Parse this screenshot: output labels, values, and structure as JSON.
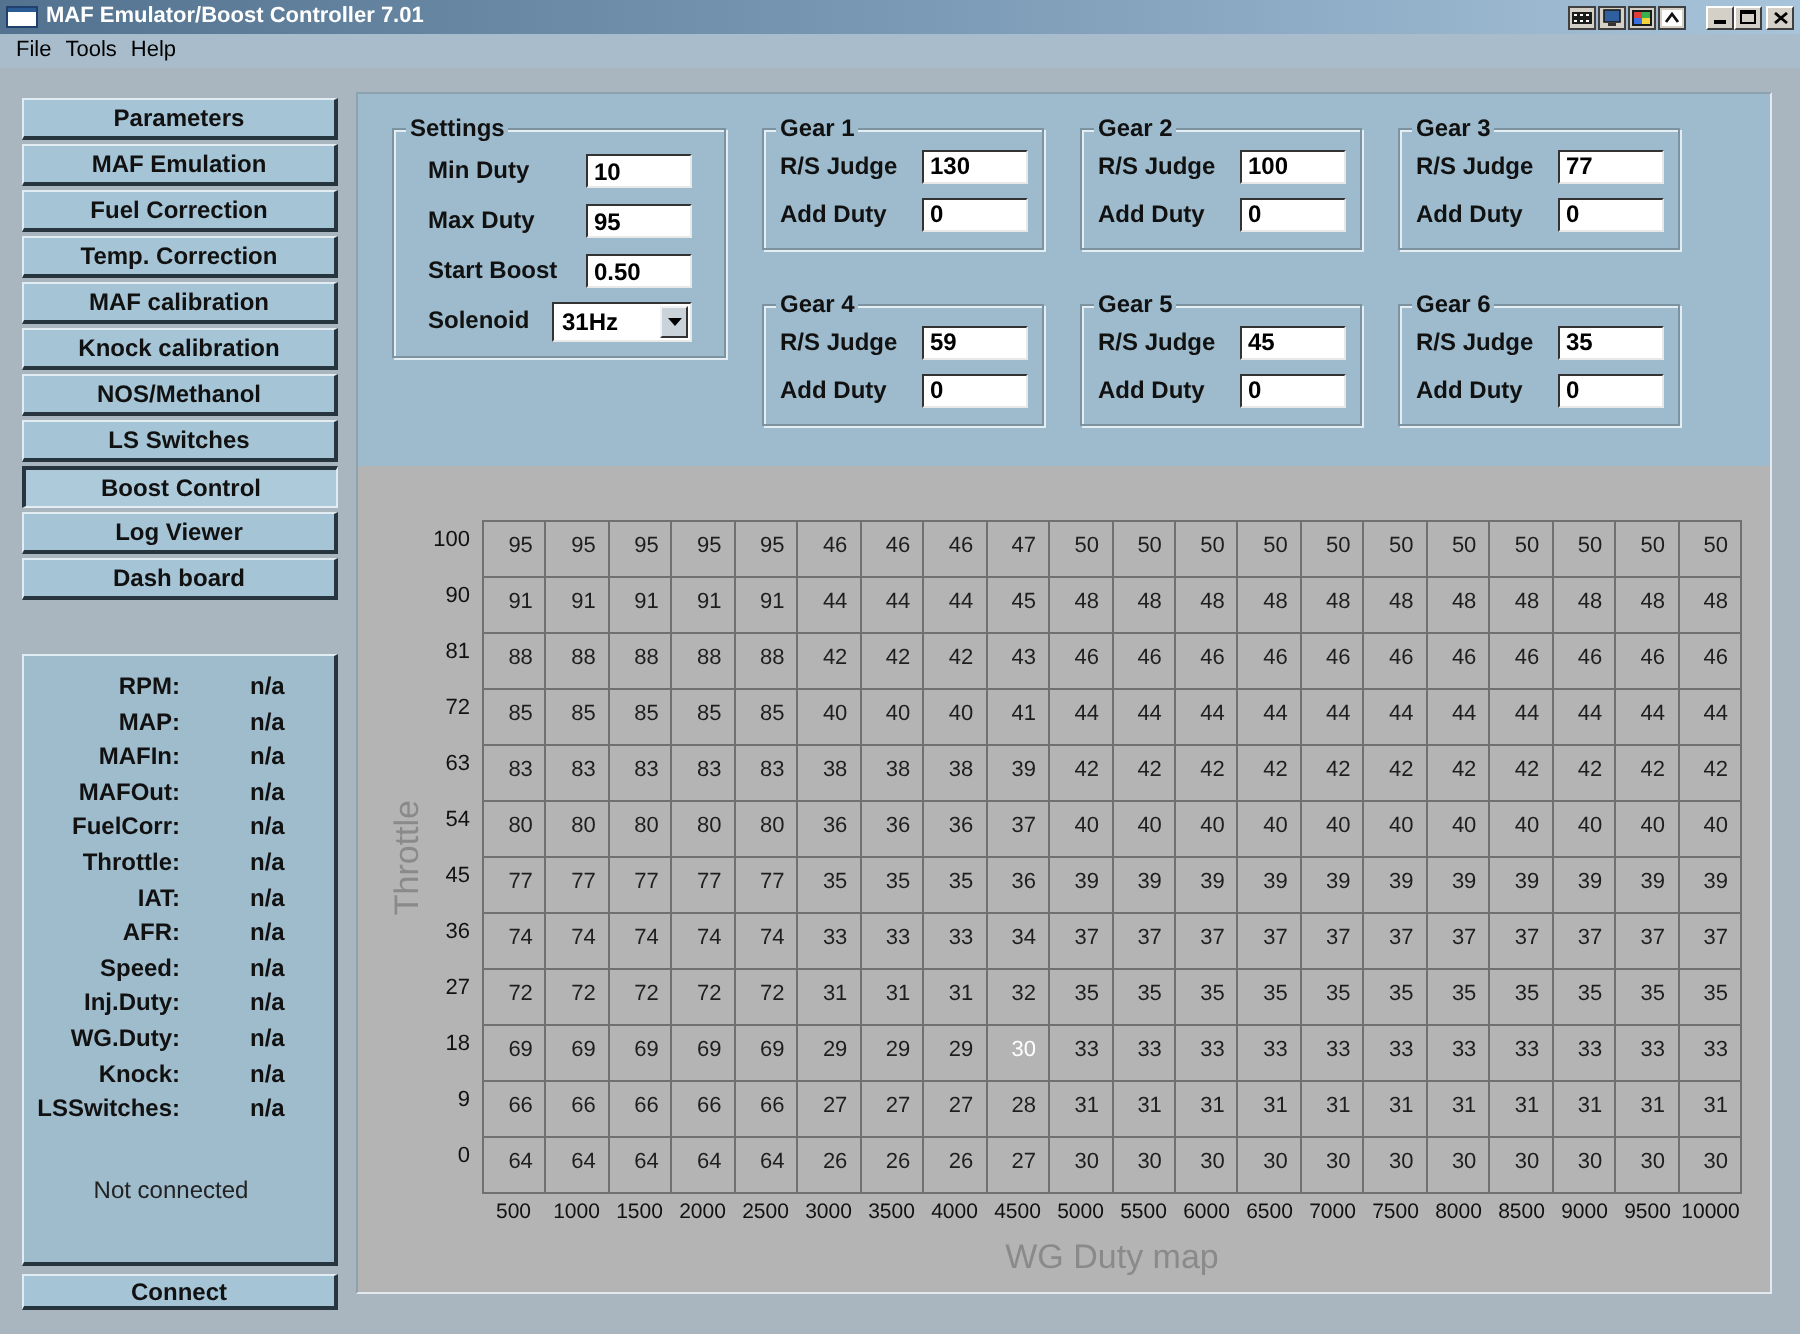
{
  "window": {
    "title": "MAF Emulator/Boost Controller 7.01"
  },
  "menu": [
    "File",
    "Tools",
    "Help"
  ],
  "nav_buttons": [
    {
      "label": "Parameters",
      "selected": false
    },
    {
      "label": "MAF Emulation",
      "selected": false
    },
    {
      "label": "Fuel Correction",
      "selected": false
    },
    {
      "label": "Temp. Correction",
      "selected": false
    },
    {
      "label": "MAF calibration",
      "selected": false
    },
    {
      "label": "Knock calibration",
      "selected": false
    },
    {
      "label": "NOS/Methanol",
      "selected": false
    },
    {
      "label": "LS Switches",
      "selected": false
    },
    {
      "label": "Boost Control",
      "selected": true
    },
    {
      "label": "Log Viewer",
      "selected": false
    },
    {
      "label": "Dash board",
      "selected": false
    }
  ],
  "status_panel": {
    "readings": [
      {
        "label": "RPM:",
        "value": "n/a"
      },
      {
        "label": "MAP:",
        "value": "n/a"
      },
      {
        "label": "MAFIn:",
        "value": "n/a"
      },
      {
        "label": "MAFOut:",
        "value": "n/a"
      },
      {
        "label": "FuelCorr:",
        "value": "n/a"
      },
      {
        "label": "Throttle:",
        "value": "n/a"
      },
      {
        "label": "IAT:",
        "value": "n/a"
      },
      {
        "label": "AFR:",
        "value": "n/a"
      },
      {
        "label": "Speed:",
        "value": "n/a"
      },
      {
        "label": "Inj.Duty:",
        "value": "n/a"
      },
      {
        "label": "WG.Duty:",
        "value": "n/a"
      },
      {
        "label": "Knock:",
        "value": "n/a"
      },
      {
        "label": "LSSwitches:",
        "value": "n/a"
      }
    ],
    "message": "Not connected"
  },
  "connect_button": "Connect",
  "settings": {
    "title": "Settings",
    "fields": [
      {
        "kind": "input",
        "label": "Min Duty",
        "value": "10"
      },
      {
        "kind": "input",
        "label": "Max Duty",
        "value": "95"
      },
      {
        "kind": "input",
        "label": "Start Boost",
        "value": "0.50"
      },
      {
        "kind": "dropdown",
        "label": "Solenoid",
        "value": "31Hz"
      }
    ]
  },
  "gears": [
    {
      "title": "Gear 1",
      "fields": [
        {
          "label": "R/S Judge",
          "value": "130"
        },
        {
          "label": "Add Duty",
          "value": "0"
        }
      ]
    },
    {
      "title": "Gear 2",
      "fields": [
        {
          "label": "R/S Judge",
          "value": "100"
        },
        {
          "label": "Add Duty",
          "value": "0"
        }
      ]
    },
    {
      "title": "Gear 3",
      "fields": [
        {
          "label": "R/S Judge",
          "value": "77"
        },
        {
          "label": "Add Duty",
          "value": "0"
        }
      ]
    },
    {
      "title": "Gear 4",
      "fields": [
        {
          "label": "R/S Judge",
          "value": "59"
        },
        {
          "label": "Add Duty",
          "value": "0"
        }
      ]
    },
    {
      "title": "Gear 5",
      "fields": [
        {
          "label": "R/S Judge",
          "value": "45"
        },
        {
          "label": "Add Duty",
          "value": "0"
        }
      ]
    },
    {
      "title": "Gear 6",
      "fields": [
        {
          "label": "R/S Judge",
          "value": "35"
        },
        {
          "label": "Add Duty",
          "value": "0"
        }
      ]
    }
  ],
  "duty_map": {
    "y_label": "Throttle",
    "rows": [
      {
        "label": "100",
        "cells": [
          {
            "value": "95",
            "selected": false
          },
          {
            "value": "95",
            "selected": false
          },
          {
            "value": "95",
            "selected": false
          },
          {
            "value": "95",
            "selected": false
          },
          {
            "value": "95",
            "selected": false
          },
          {
            "value": "46",
            "selected": false
          },
          {
            "value": "46",
            "selected": false
          },
          {
            "value": "46",
            "selected": false
          },
          {
            "value": "47",
            "selected": false
          },
          {
            "value": "50",
            "selected": false
          },
          {
            "value": "50",
            "selected": false
          },
          {
            "value": "50",
            "selected": false
          },
          {
            "value": "50",
            "selected": false
          },
          {
            "value": "50",
            "selected": false
          },
          {
            "value": "50",
            "selected": false
          },
          {
            "value": "50",
            "selected": false
          },
          {
            "value": "50",
            "selected": false
          },
          {
            "value": "50",
            "selected": false
          },
          {
            "value": "50",
            "selected": false
          },
          {
            "value": "50",
            "selected": false
          }
        ]
      },
      {
        "label": "90",
        "cells": [
          {
            "value": "91",
            "selected": false
          },
          {
            "value": "91",
            "selected": false
          },
          {
            "value": "91",
            "selected": false
          },
          {
            "value": "91",
            "selected": false
          },
          {
            "value": "91",
            "selected": false
          },
          {
            "value": "44",
            "selected": false
          },
          {
            "value": "44",
            "selected": false
          },
          {
            "value": "44",
            "selected": false
          },
          {
            "value": "45",
            "selected": false
          },
          {
            "value": "48",
            "selected": false
          },
          {
            "value": "48",
            "selected": false
          },
          {
            "value": "48",
            "selected": false
          },
          {
            "value": "48",
            "selected": false
          },
          {
            "value": "48",
            "selected": false
          },
          {
            "value": "48",
            "selected": false
          },
          {
            "value": "48",
            "selected": false
          },
          {
            "value": "48",
            "selected": false
          },
          {
            "value": "48",
            "selected": false
          },
          {
            "value": "48",
            "selected": false
          },
          {
            "value": "48",
            "selected": false
          }
        ]
      },
      {
        "label": "81",
        "cells": [
          {
            "value": "88",
            "selected": false
          },
          {
            "value": "88",
            "selected": false
          },
          {
            "value": "88",
            "selected": false
          },
          {
            "value": "88",
            "selected": false
          },
          {
            "value": "88",
            "selected": false
          },
          {
            "value": "42",
            "selected": false
          },
          {
            "value": "42",
            "selected": false
          },
          {
            "value": "42",
            "selected": false
          },
          {
            "value": "43",
            "selected": false
          },
          {
            "value": "46",
            "selected": false
          },
          {
            "value": "46",
            "selected": false
          },
          {
            "value": "46",
            "selected": false
          },
          {
            "value": "46",
            "selected": false
          },
          {
            "value": "46",
            "selected": false
          },
          {
            "value": "46",
            "selected": false
          },
          {
            "value": "46",
            "selected": false
          },
          {
            "value": "46",
            "selected": false
          },
          {
            "value": "46",
            "selected": false
          },
          {
            "value": "46",
            "selected": false
          },
          {
            "value": "46",
            "selected": false
          }
        ]
      },
      {
        "label": "72",
        "cells": [
          {
            "value": "85",
            "selected": false
          },
          {
            "value": "85",
            "selected": false
          },
          {
            "value": "85",
            "selected": false
          },
          {
            "value": "85",
            "selected": false
          },
          {
            "value": "85",
            "selected": false
          },
          {
            "value": "40",
            "selected": false
          },
          {
            "value": "40",
            "selected": false
          },
          {
            "value": "40",
            "selected": false
          },
          {
            "value": "41",
            "selected": false
          },
          {
            "value": "44",
            "selected": false
          },
          {
            "value": "44",
            "selected": false
          },
          {
            "value": "44",
            "selected": false
          },
          {
            "value": "44",
            "selected": false
          },
          {
            "value": "44",
            "selected": false
          },
          {
            "value": "44",
            "selected": false
          },
          {
            "value": "44",
            "selected": false
          },
          {
            "value": "44",
            "selected": false
          },
          {
            "value": "44",
            "selected": false
          },
          {
            "value": "44",
            "selected": false
          },
          {
            "value": "44",
            "selected": false
          }
        ]
      },
      {
        "label": "63",
        "cells": [
          {
            "value": "83",
            "selected": false
          },
          {
            "value": "83",
            "selected": false
          },
          {
            "value": "83",
            "selected": false
          },
          {
            "value": "83",
            "selected": false
          },
          {
            "value": "83",
            "selected": false
          },
          {
            "value": "38",
            "selected": false
          },
          {
            "value": "38",
            "selected": false
          },
          {
            "value": "38",
            "selected": false
          },
          {
            "value": "39",
            "selected": false
          },
          {
            "value": "42",
            "selected": false
          },
          {
            "value": "42",
            "selected": false
          },
          {
            "value": "42",
            "selected": false
          },
          {
            "value": "42",
            "selected": false
          },
          {
            "value": "42",
            "selected": false
          },
          {
            "value": "42",
            "selected": false
          },
          {
            "value": "42",
            "selected": false
          },
          {
            "value": "42",
            "selected": false
          },
          {
            "value": "42",
            "selected": false
          },
          {
            "value": "42",
            "selected": false
          },
          {
            "value": "42",
            "selected": false
          }
        ]
      },
      {
        "label": "54",
        "cells": [
          {
            "value": "80",
            "selected": false
          },
          {
            "value": "80",
            "selected": false
          },
          {
            "value": "80",
            "selected": false
          },
          {
            "value": "80",
            "selected": false
          },
          {
            "value": "80",
            "selected": false
          },
          {
            "value": "36",
            "selected": false
          },
          {
            "value": "36",
            "selected": false
          },
          {
            "value": "36",
            "selected": false
          },
          {
            "value": "37",
            "selected": false
          },
          {
            "value": "40",
            "selected": false
          },
          {
            "value": "40",
            "selected": false
          },
          {
            "value": "40",
            "selected": false
          },
          {
            "value": "40",
            "selected": false
          },
          {
            "value": "40",
            "selected": false
          },
          {
            "value": "40",
            "selected": false
          },
          {
            "value": "40",
            "selected": false
          },
          {
            "value": "40",
            "selected": false
          },
          {
            "value": "40",
            "selected": false
          },
          {
            "value": "40",
            "selected": false
          },
          {
            "value": "40",
            "selected": false
          }
        ]
      },
      {
        "label": "45",
        "cells": [
          {
            "value": "77",
            "selected": false
          },
          {
            "value": "77",
            "selected": false
          },
          {
            "value": "77",
            "selected": false
          },
          {
            "value": "77",
            "selected": false
          },
          {
            "value": "77",
            "selected": false
          },
          {
            "value": "35",
            "selected": false
          },
          {
            "value": "35",
            "selected": false
          },
          {
            "value": "35",
            "selected": false
          },
          {
            "value": "36",
            "selected": false
          },
          {
            "value": "39",
            "selected": false
          },
          {
            "value": "39",
            "selected": false
          },
          {
            "value": "39",
            "selected": false
          },
          {
            "value": "39",
            "selected": false
          },
          {
            "value": "39",
            "selected": false
          },
          {
            "value": "39",
            "selected": false
          },
          {
            "value": "39",
            "selected": false
          },
          {
            "value": "39",
            "selected": false
          },
          {
            "value": "39",
            "selected": false
          },
          {
            "value": "39",
            "selected": false
          },
          {
            "value": "39",
            "selected": false
          }
        ]
      },
      {
        "label": "36",
        "cells": [
          {
            "value": "74",
            "selected": false
          },
          {
            "value": "74",
            "selected": false
          },
          {
            "value": "74",
            "selected": false
          },
          {
            "value": "74",
            "selected": false
          },
          {
            "value": "74",
            "selected": false
          },
          {
            "value": "33",
            "selected": false
          },
          {
            "value": "33",
            "selected": false
          },
          {
            "value": "33",
            "selected": false
          },
          {
            "value": "34",
            "selected": false
          },
          {
            "value": "37",
            "selected": false
          },
          {
            "value": "37",
            "selected": false
          },
          {
            "value": "37",
            "selected": false
          },
          {
            "value": "37",
            "selected": false
          },
          {
            "value": "37",
            "selected": false
          },
          {
            "value": "37",
            "selected": false
          },
          {
            "value": "37",
            "selected": false
          },
          {
            "value": "37",
            "selected": false
          },
          {
            "value": "37",
            "selected": false
          },
          {
            "value": "37",
            "selected": false
          },
          {
            "value": "37",
            "selected": false
          }
        ]
      },
      {
        "label": "27",
        "cells": [
          {
            "value": "72",
            "selected": false
          },
          {
            "value": "72",
            "selected": false
          },
          {
            "value": "72",
            "selected": false
          },
          {
            "value": "72",
            "selected": false
          },
          {
            "value": "72",
            "selected": false
          },
          {
            "value": "31",
            "selected": false
          },
          {
            "value": "31",
            "selected": false
          },
          {
            "value": "31",
            "selected": false
          },
          {
            "value": "32",
            "selected": false
          },
          {
            "value": "35",
            "selected": false
          },
          {
            "value": "35",
            "selected": false
          },
          {
            "value": "35",
            "selected": false
          },
          {
            "value": "35",
            "selected": false
          },
          {
            "value": "35",
            "selected": false
          },
          {
            "value": "35",
            "selected": false
          },
          {
            "value": "35",
            "selected": false
          },
          {
            "value": "35",
            "selected": false
          },
          {
            "value": "35",
            "selected": false
          },
          {
            "value": "35",
            "selected": false
          },
          {
            "value": "35",
            "selected": false
          }
        ]
      },
      {
        "label": "18",
        "cells": [
          {
            "value": "69",
            "selected": false
          },
          {
            "value": "69",
            "selected": false
          },
          {
            "value": "69",
            "selected": false
          },
          {
            "value": "69",
            "selected": false
          },
          {
            "value": "69",
            "selected": false
          },
          {
            "value": "29",
            "selected": false
          },
          {
            "value": "29",
            "selected": false
          },
          {
            "value": "29",
            "selected": false
          },
          {
            "value": "30",
            "selected": true
          },
          {
            "value": "33",
            "selected": false
          },
          {
            "value": "33",
            "selected": false
          },
          {
            "value": "33",
            "selected": false
          },
          {
            "value": "33",
            "selected": false
          },
          {
            "value": "33",
            "selected": false
          },
          {
            "value": "33",
            "selected": false
          },
          {
            "value": "33",
            "selected": false
          },
          {
            "value": "33",
            "selected": false
          },
          {
            "value": "33",
            "selected": false
          },
          {
            "value": "33",
            "selected": false
          },
          {
            "value": "33",
            "selected": false
          }
        ]
      },
      {
        "label": "9",
        "cells": [
          {
            "value": "66",
            "selected": false
          },
          {
            "value": "66",
            "selected": false
          },
          {
            "value": "66",
            "selected": false
          },
          {
            "value": "66",
            "selected": false
          },
          {
            "value": "66",
            "selected": false
          },
          {
            "value": "27",
            "selected": false
          },
          {
            "value": "27",
            "selected": false
          },
          {
            "value": "27",
            "selected": false
          },
          {
            "value": "28",
            "selected": false
          },
          {
            "value": "31",
            "selected": false
          },
          {
            "value": "31",
            "selected": false
          },
          {
            "value": "31",
            "selected": false
          },
          {
            "value": "31",
            "selected": false
          },
          {
            "value": "31",
            "selected": false
          },
          {
            "value": "31",
            "selected": false
          },
          {
            "value": "31",
            "selected": false
          },
          {
            "value": "31",
            "selected": false
          },
          {
            "value": "31",
            "selected": false
          },
          {
            "value": "31",
            "selected": false
          },
          {
            "value": "31",
            "selected": false
          }
        ]
      },
      {
        "label": "0",
        "cells": [
          {
            "value": "64",
            "selected": false
          },
          {
            "value": "64",
            "selected": false
          },
          {
            "value": "64",
            "selected": false
          },
          {
            "value": "64",
            "selected": false
          },
          {
            "value": "64",
            "selected": false
          },
          {
            "value": "26",
            "selected": false
          },
          {
            "value": "26",
            "selected": false
          },
          {
            "value": "26",
            "selected": false
          },
          {
            "value": "27",
            "selected": false
          },
          {
            "value": "30",
            "selected": false
          },
          {
            "value": "30",
            "selected": false
          },
          {
            "value": "30",
            "selected": false
          },
          {
            "value": "30",
            "selected": false
          },
          {
            "value": "30",
            "selected": false
          },
          {
            "value": "30",
            "selected": false
          },
          {
            "value": "30",
            "selected": false
          },
          {
            "value": "30",
            "selected": false
          },
          {
            "value": "30",
            "selected": false
          },
          {
            "value": "30",
            "selected": false
          },
          {
            "value": "30",
            "selected": false
          }
        ]
      }
    ],
    "x_axis_labels": [
      "500",
      "1000",
      "1500",
      "2000",
      "2500",
      "3000",
      "3500",
      "4000",
      "4500",
      "5000",
      "5500",
      "6000",
      "6500",
      "7000",
      "7500",
      "8000",
      "8500",
      "9000",
      "9500",
      "10000"
    ],
    "title": "WG Duty map"
  }
}
